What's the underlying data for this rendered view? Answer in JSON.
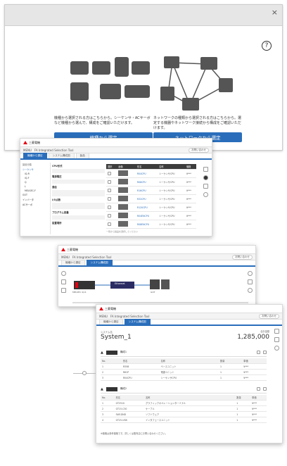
{
  "dialog": {
    "close_label": "×",
    "help_label": "?",
    "left": {
      "text": "機種から選択される方はこちらから。シーケンサ・ACサーボなど機種から選んで、構成をご確認いただけます。",
      "button": "機種から選定"
    },
    "right": {
      "text": "ネットワークの種類から選択される方はこちらから。選定する機器やネットワーク接続から構成をご確認いただけます。",
      "button": "ネットワークから選定"
    }
  },
  "app": {
    "brand": "三菱電機",
    "menu_label": "MENU",
    "title": "FA Integrated Selection Tool",
    "cta": "お問い合わせ",
    "tab_model": "機種から選定",
    "tab_system": "システム構成図"
  },
  "screen2": {
    "tab_active": "製品",
    "panel_header": "製品分類",
    "tree": [
      "シーケンサ",
      "iQ-R",
      "iQ-F",
      "Q",
      "L",
      "MELSEC-F",
      "GOT",
      "インバータ",
      "ACサーボ"
    ],
    "filter_groups": [
      "CPU形式",
      "電源電圧",
      "通信",
      "I/O点数",
      "プログラム容量",
      "設置場所"
    ],
    "table_headers": [
      "選択",
      "画像",
      "形名",
      "名称",
      "価格",
      ""
    ],
    "rows": [
      {
        "model": "R04CPU",
        "name": "シーケンサCPU",
        "price": "¥***"
      },
      {
        "model": "R08CPU",
        "name": "シーケンサCPU",
        "price": "¥***"
      },
      {
        "model": "R16CPU",
        "name": "シーケンサCPU",
        "price": "¥***"
      },
      {
        "model": "R32CPU",
        "name": "シーケンサCPU",
        "price": "¥***"
      },
      {
        "model": "R120CPU",
        "name": "シーケンサCPU",
        "price": "¥***"
      },
      {
        "model": "R04ENCPU",
        "name": "シーケンサCPU",
        "price": "¥***"
      },
      {
        "model": "R08ENCPU",
        "name": "シーケンサCPU",
        "price": "¥***"
      }
    ],
    "footer_note": "一覧から製品を選択してください"
  },
  "screen3": {
    "network_label": "Ethernet",
    "left_device": "MELSEC iQ-R",
    "right_device": "GOT"
  },
  "screen4": {
    "section_label": "システム名",
    "system_name": "System_1",
    "total_label": "合計金額",
    "total_value": "1,285,000",
    "group1": {
      "label": "構成1",
      "items": [
        {
          "no": "1",
          "model": "R35B",
          "name": "ベースユニット",
          "qty": "1",
          "price": "¥***"
        },
        {
          "no": "2",
          "model": "R61P",
          "name": "電源ユニット",
          "qty": "1",
          "price": "¥***"
        },
        {
          "no": "3",
          "model": "R04CPU",
          "name": "シーケンサCPU",
          "qty": "1",
          "price": "¥***"
        }
      ]
    },
    "group2": {
      "label": "構成2",
      "items": [
        {
          "no": "1",
          "model": "GT2510",
          "name": "グラフィックオペレーションターミナル",
          "qty": "1",
          "price": "¥***"
        },
        {
          "no": "2",
          "model": "GT15-C30",
          "name": "ケーブル",
          "qty": "1",
          "price": "¥***"
        },
        {
          "no": "3",
          "model": "SW1DND",
          "name": "ソフトウェア",
          "qty": "1",
          "price": "¥***"
        },
        {
          "no": "4",
          "model": "GT25-USB",
          "name": "インタフェースユニット",
          "qty": "1",
          "price": "¥***"
        }
      ]
    },
    "table_headers": [
      "No.",
      "形名",
      "名称",
      "数量",
      "単価"
    ],
    "notes": "※価格は参考価格です。詳しくは販売店にお問い合わせください。"
  }
}
